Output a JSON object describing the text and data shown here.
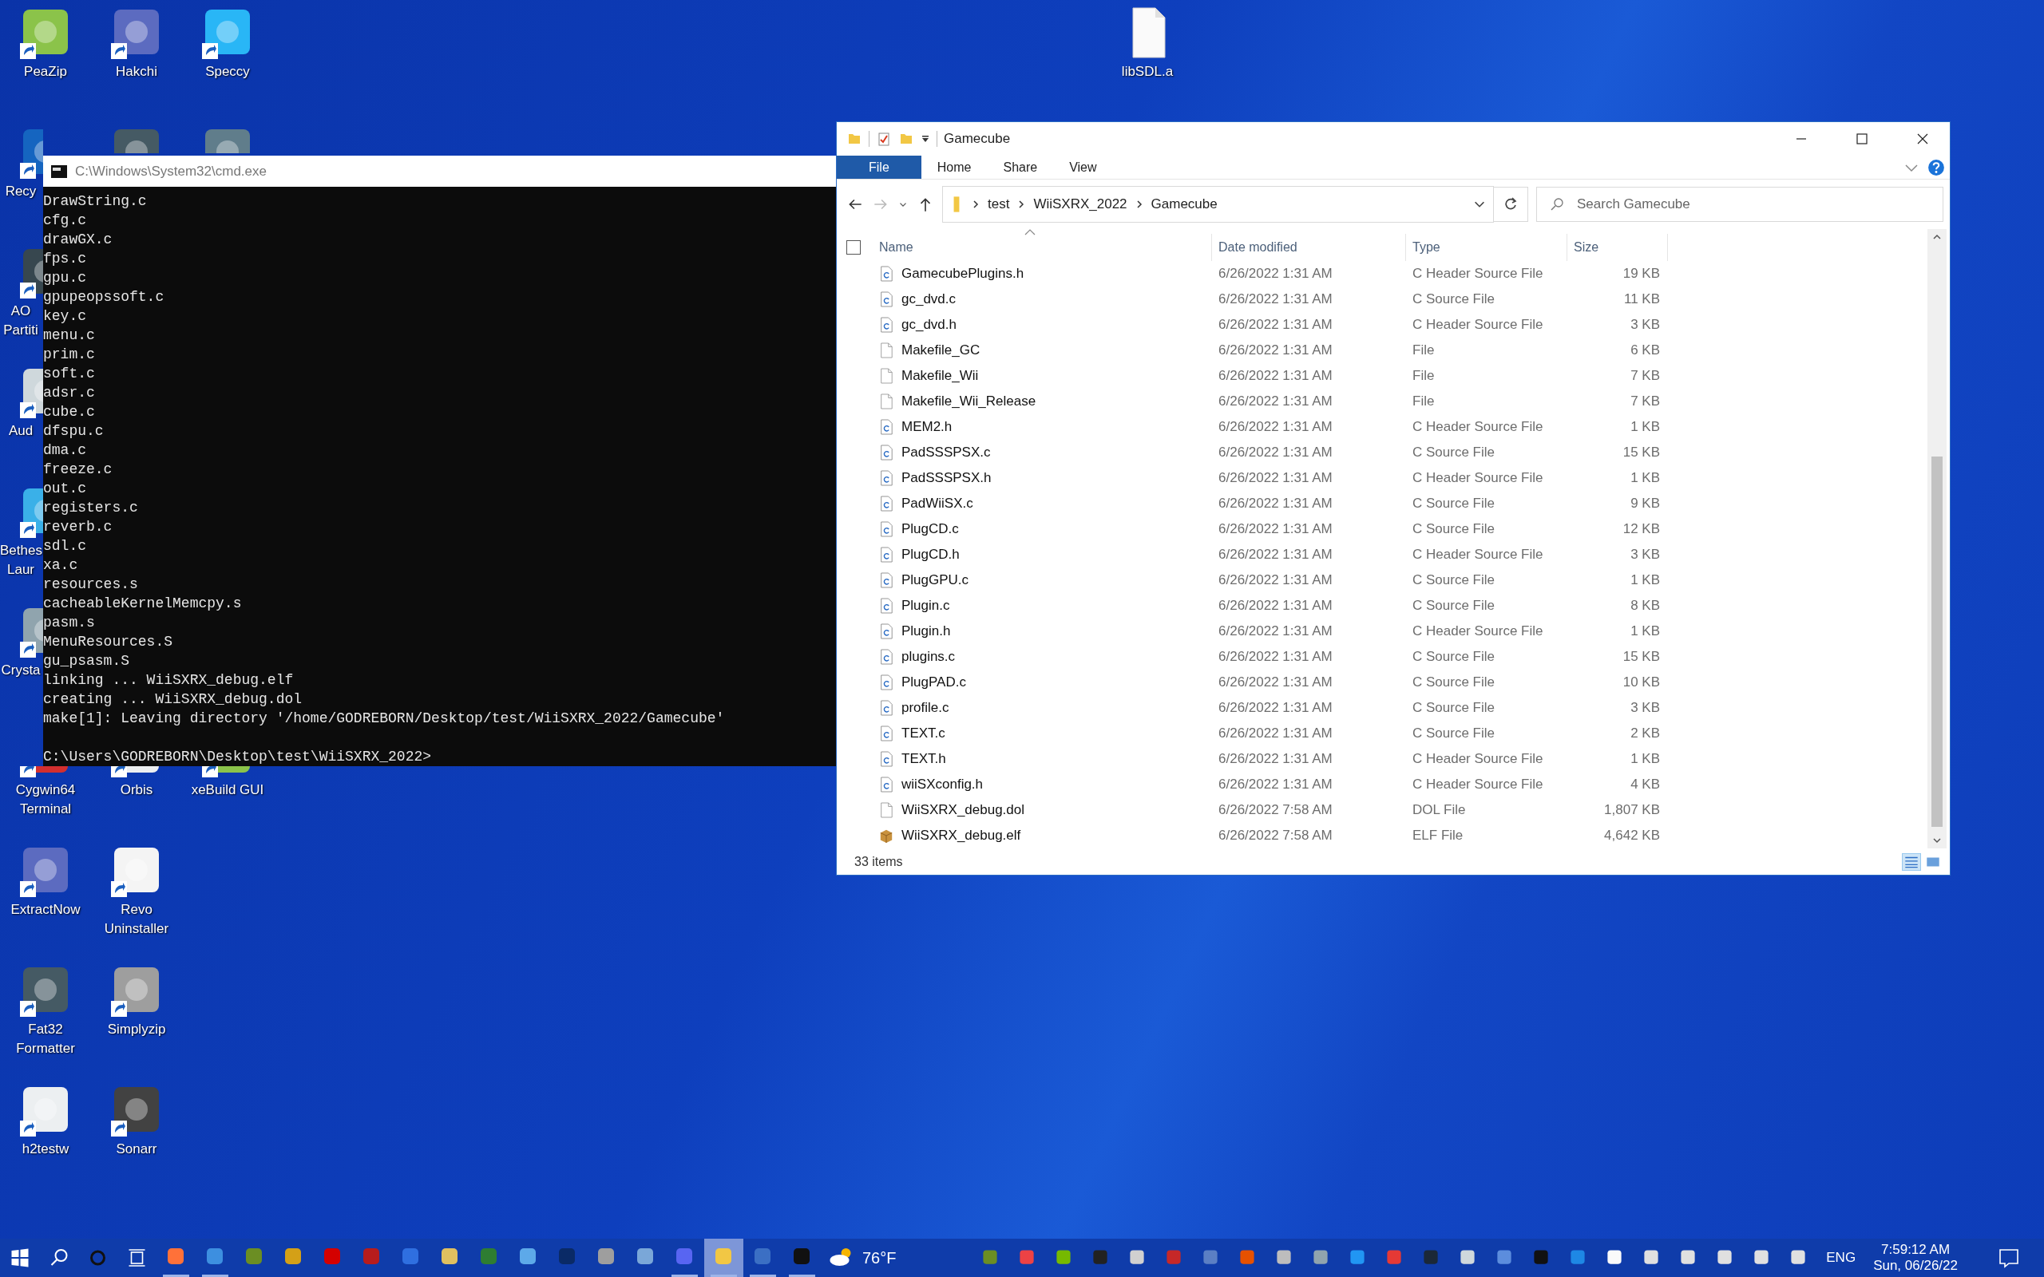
{
  "desktop": {
    "icon_columns": [
      [
        {
          "label": "PeaZip"
        },
        {
          "label": "Recy"
        },
        {
          "label": "AO Partiti"
        },
        {
          "label": "Aud"
        },
        {
          "label": "Bethes Laur"
        },
        {
          "label": "Crysta"
        },
        {
          "kind": "lower",
          "label": "Cygwin64 Terminal"
        },
        {
          "label": "ExtractNow"
        },
        {
          "label": "Fat32 Formatter"
        },
        {
          "label": "h2testw"
        }
      ],
      [
        {
          "label": "Hakchi"
        },
        {
          "kind": "upper"
        },
        {
          "kind": "lower",
          "label": "Orbis"
        },
        {
          "label": "Revo Uninstaller"
        },
        {
          "label": "Simplyzip"
        },
        {
          "label": "Sonarr"
        }
      ],
      [
        {
          "label": "Speccy"
        },
        {
          "kind": "upper"
        },
        {
          "kind": "lower",
          "label": "xeBuild GUI"
        }
      ]
    ],
    "loose_icons": [
      {
        "label": "libSDL.a"
      }
    ]
  },
  "cmd_window": {
    "title": "C:\\Windows\\System32\\cmd.exe",
    "lines": [
      "DrawString.c",
      "cfg.c",
      "drawGX.c",
      "fps.c",
      "gpu.c",
      "gpupeopssoft.c",
      "key.c",
      "menu.c",
      "prim.c",
      "soft.c",
      "adsr.c",
      "cube.c",
      "dfspu.c",
      "dma.c",
      "freeze.c",
      "out.c",
      "registers.c",
      "reverb.c",
      "sdl.c",
      "xa.c",
      "resources.s",
      "cacheableKernelMemcpy.s",
      "pasm.s",
      "MenuResources.S",
      "gu_psasm.S",
      "linking ... WiiSXRX_debug.elf",
      "creating ... WiiSXRX_debug.dol",
      "make[1]: Leaving directory '/home/GODREBORN/Desktop/test/WiiSXRX_2022/Gamecube'"
    ],
    "prompt": "C:\\Users\\GODREBORN\\Desktop\\test\\WiiSXRX_2022>"
  },
  "explorer": {
    "title": "Gamecube",
    "ribbon_tabs": [
      {
        "label": "File",
        "selected": true
      },
      {
        "label": "Home",
        "selected": false
      },
      {
        "label": "Share",
        "selected": false
      },
      {
        "label": "View",
        "selected": false
      }
    ],
    "breadcrumb": [
      "test",
      "WiiSXRX_2022",
      "Gamecube"
    ],
    "search": {
      "placeholder": "Search Gamecube"
    },
    "select_all": {
      "checked": false
    },
    "columns": [
      "Name",
      "Date modified",
      "Type",
      "Size"
    ],
    "files": [
      {
        "kind": "source",
        "name": "GamecubePlugins.h",
        "date": "6/26/2022 1:31 AM",
        "type": "C Header Source File",
        "size": "19 KB"
      },
      {
        "kind": "source",
        "name": "gc_dvd.c",
        "date": "6/26/2022 1:31 AM",
        "type": "C Source File",
        "size": "11 KB"
      },
      {
        "kind": "source",
        "name": "gc_dvd.h",
        "date": "6/26/2022 1:31 AM",
        "type": "C Header Source File",
        "size": "3 KB"
      },
      {
        "kind": "plain",
        "name": "Makefile_GC",
        "date": "6/26/2022 1:31 AM",
        "type": "File",
        "size": "6 KB"
      },
      {
        "kind": "plain",
        "name": "Makefile_Wii",
        "date": "6/26/2022 1:31 AM",
        "type": "File",
        "size": "7 KB"
      },
      {
        "kind": "plain",
        "name": "Makefile_Wii_Release",
        "date": "6/26/2022 1:31 AM",
        "type": "File",
        "size": "7 KB"
      },
      {
        "kind": "source",
        "name": "MEM2.h",
        "date": "6/26/2022 1:31 AM",
        "type": "C Header Source File",
        "size": "1 KB"
      },
      {
        "kind": "source",
        "name": "PadSSSPSX.c",
        "date": "6/26/2022 1:31 AM",
        "type": "C Source File",
        "size": "15 KB"
      },
      {
        "kind": "source",
        "name": "PadSSSPSX.h",
        "date": "6/26/2022 1:31 AM",
        "type": "C Header Source File",
        "size": "1 KB"
      },
      {
        "kind": "source",
        "name": "PadWiiSX.c",
        "date": "6/26/2022 1:31 AM",
        "type": "C Source File",
        "size": "9 KB"
      },
      {
        "kind": "source",
        "name": "PlugCD.c",
        "date": "6/26/2022 1:31 AM",
        "type": "C Source File",
        "size": "12 KB"
      },
      {
        "kind": "source",
        "name": "PlugCD.h",
        "date": "6/26/2022 1:31 AM",
        "type": "C Header Source File",
        "size": "3 KB"
      },
      {
        "kind": "source",
        "name": "PlugGPU.c",
        "date": "6/26/2022 1:31 AM",
        "type": "C Source File",
        "size": "1 KB"
      },
      {
        "kind": "source",
        "name": "Plugin.c",
        "date": "6/26/2022 1:31 AM",
        "type": "C Source File",
        "size": "8 KB"
      },
      {
        "kind": "source",
        "name": "Plugin.h",
        "date": "6/26/2022 1:31 AM",
        "type": "C Header Source File",
        "size": "1 KB"
      },
      {
        "kind": "source",
        "name": "plugins.c",
        "date": "6/26/2022 1:31 AM",
        "type": "C Source File",
        "size": "15 KB"
      },
      {
        "kind": "source",
        "name": "PlugPAD.c",
        "date": "6/26/2022 1:31 AM",
        "type": "C Source File",
        "size": "10 KB"
      },
      {
        "kind": "source",
        "name": "profile.c",
        "date": "6/26/2022 1:31 AM",
        "type": "C Source File",
        "size": "3 KB"
      },
      {
        "kind": "source",
        "name": "TEXT.c",
        "date": "6/26/2022 1:31 AM",
        "type": "C Source File",
        "size": "2 KB"
      },
      {
        "kind": "source",
        "name": "TEXT.h",
        "date": "6/26/2022 1:31 AM",
        "type": "C Header Source File",
        "size": "1 KB"
      },
      {
        "kind": "source",
        "name": "wiiSXconfig.h",
        "date": "6/26/2022 1:31 AM",
        "type": "C Header Source File",
        "size": "4 KB"
      },
      {
        "kind": "plain",
        "name": "WiiSXRX_debug.dol",
        "date": "6/26/2022 7:58 AM",
        "type": "DOL File",
        "size": "1,807 KB"
      },
      {
        "kind": "package",
        "name": "WiiSXRX_debug.elf",
        "date": "6/26/2022 7:58 AM",
        "type": "ELF File",
        "size": "4,642 KB"
      }
    ],
    "status": "33 items"
  },
  "taskbar": {
    "apps": [
      {
        "running": true,
        "selected": false
      },
      {
        "running": true,
        "selected": false
      },
      {
        "running": false,
        "selected": false
      },
      {
        "running": false,
        "selected": false
      },
      {
        "running": false,
        "selected": false
      },
      {
        "running": false,
        "selected": false
      },
      {
        "running": false,
        "selected": false
      },
      {
        "running": false,
        "selected": false
      },
      {
        "running": false,
        "selected": false
      },
      {
        "running": false,
        "selected": false
      },
      {
        "running": false,
        "selected": false
      },
      {
        "running": false,
        "selected": false
      },
      {
        "running": false,
        "selected": false
      },
      {
        "running": true,
        "selected": false
      },
      {
        "running": true,
        "selected": true
      },
      {
        "running": true,
        "selected": false
      },
      {
        "running": true,
        "selected": false
      }
    ],
    "weather": "76°F",
    "language": "ENG",
    "time": "7:59:12 AM",
    "date": "Sun, 06/26/22"
  }
}
